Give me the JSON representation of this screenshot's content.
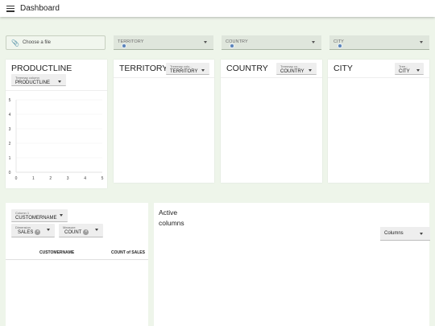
{
  "header": {
    "title": "Dashboard",
    "menu_icon": "menu-icon"
  },
  "file_input": {
    "label": "Choose a file",
    "icon": "paperclip-icon"
  },
  "filters": [
    {
      "label": "TERRITORY"
    },
    {
      "label": "COUNTRY"
    },
    {
      "label": "CITY"
    }
  ],
  "cards": {
    "productline": {
      "title": "PRODUCTLINE",
      "select_label": "Treemap column",
      "select_value": "PRODUCTLINE"
    },
    "territory": {
      "title": "TERRITORY",
      "select_label": "Treemap colu...",
      "select_value": "TERRITORY"
    },
    "country": {
      "title": "COUNTRY",
      "select_label": "Treemap co...",
      "select_value": "COUNTRY"
    },
    "city": {
      "title": "CITY",
      "select_label": "Tree...",
      "select_value": "CITY"
    }
  },
  "chart_data": {
    "type": "bar",
    "categories": [],
    "x_ticks": [
      "0",
      "1",
      "2",
      "3",
      "4",
      "5"
    ],
    "y_ticks": [
      "0",
      "1",
      "2",
      "3",
      "4",
      "5"
    ],
    "xlim": [
      0,
      5
    ],
    "ylim": [
      0,
      5
    ],
    "grid": true
  },
  "table_panel": {
    "column_select": {
      "label": "Column 1",
      "value": "CUSTOMERNAME"
    },
    "dimension_select": {
      "label": "Dimension",
      "chip": "SALES"
    },
    "measure_select": {
      "label": "Measure",
      "chip": "COUNT"
    },
    "headers": [
      "CUSTOMERNAME",
      "COUNT of SALES"
    ]
  },
  "active_columns": {
    "title_line1": "Active",
    "title_line2": "columns",
    "select_value": "Columns"
  }
}
